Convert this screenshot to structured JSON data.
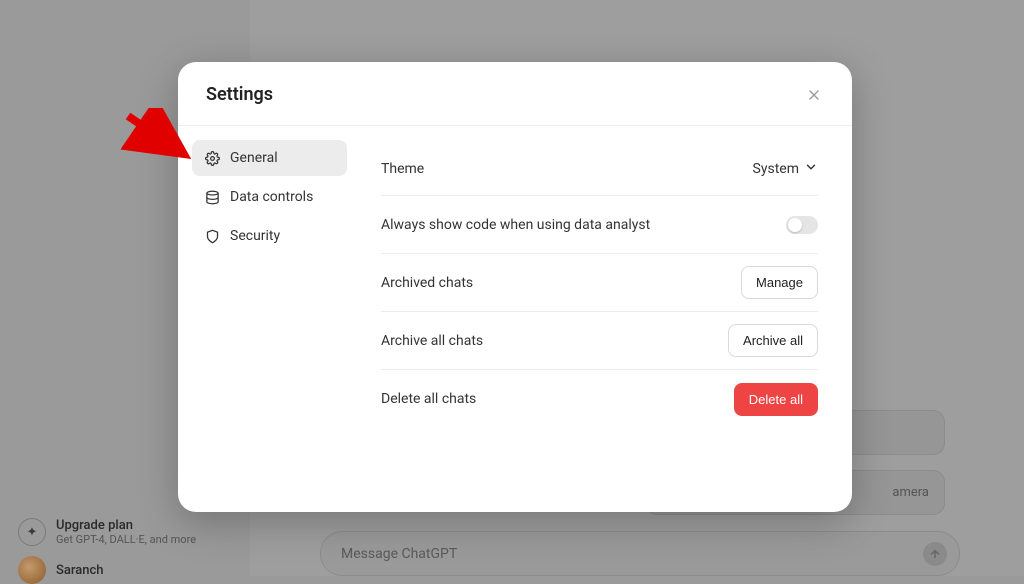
{
  "modal": {
    "title": "Settings",
    "nav": {
      "items": [
        {
          "label": "General",
          "icon": "gear-icon"
        },
        {
          "label": "Data controls",
          "icon": "database-icon"
        },
        {
          "label": "Security",
          "icon": "shield-icon"
        }
      ]
    },
    "content": {
      "theme": {
        "label": "Theme",
        "value": "System"
      },
      "code_toggle": {
        "label": "Always show code when using data analyst"
      },
      "archived": {
        "label": "Archived chats",
        "action": "Manage"
      },
      "archive_all": {
        "label": "Archive all chats",
        "action": "Archive all"
      },
      "delete_all": {
        "label": "Delete all chats",
        "action": "Delete all"
      }
    }
  },
  "background": {
    "message_placeholder": "Message ChatGPT",
    "card_camera": "amera",
    "upgrade": {
      "title": "Upgrade plan",
      "subtitle": "Get GPT-4, DALL·E, and more"
    },
    "avatar_name": "Saranch"
  }
}
